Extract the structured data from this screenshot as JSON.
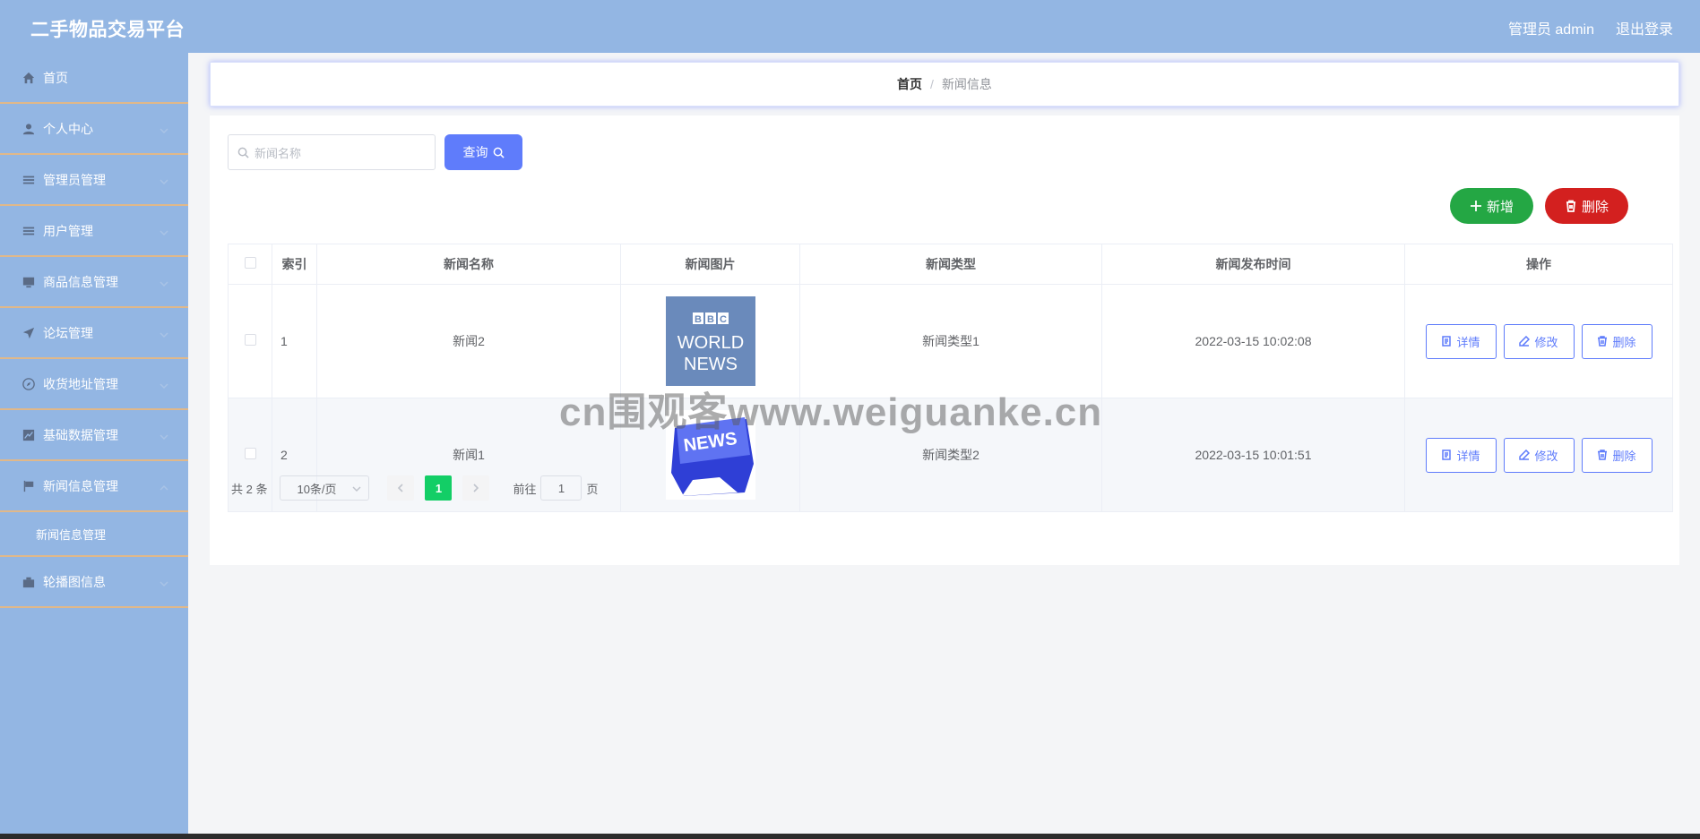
{
  "header": {
    "title": "二手物品交易平台",
    "user_label": "管理员 admin",
    "logout_label": "退出登录"
  },
  "sidebar": {
    "items": [
      {
        "label": "首页",
        "icon": "home-icon"
      },
      {
        "label": "个人中心",
        "icon": "user-icon"
      },
      {
        "label": "管理员管理",
        "icon": "list-icon"
      },
      {
        "label": "用户管理",
        "icon": "list-icon"
      },
      {
        "label": "商品信息管理",
        "icon": "monitor-icon"
      },
      {
        "label": "论坛管理",
        "icon": "send-icon"
      },
      {
        "label": "收货地址管理",
        "icon": "compass-icon"
      },
      {
        "label": "基础数据管理",
        "icon": "chart-icon"
      },
      {
        "label": "新闻信息管理",
        "icon": "flag-icon"
      },
      {
        "label": "轮播图信息",
        "icon": "briefcase-icon"
      }
    ],
    "submenu": {
      "label": "新闻信息管理"
    }
  },
  "breadcrumb": {
    "home": "首页",
    "separator": "/",
    "current": "新闻信息"
  },
  "search": {
    "placeholder": "新闻名称",
    "button_label": "查询"
  },
  "actions": {
    "add_label": "新增",
    "delete_label": "删除"
  },
  "table": {
    "headers": [
      "索引",
      "新闻名称",
      "新闻图片",
      "新闻类型",
      "新闻发布时间",
      "操作"
    ],
    "rows": [
      {
        "index": "1",
        "name": "新闻2",
        "image_text": "BBC WORLD NEWS",
        "type": "新闻类型1",
        "time": "2022-03-15 10:02:08"
      },
      {
        "index": "2",
        "name": "新闻1",
        "image_text": "NEWS",
        "type": "新闻类型2",
        "time": "2022-03-15 10:01:51"
      }
    ],
    "row_actions": {
      "detail": "详情",
      "edit": "修改",
      "delete": "删除"
    }
  },
  "pagination": {
    "total": "共 2 条",
    "page_size": "10条/页",
    "current_page": "1",
    "goto_prefix": "前往",
    "goto_value": "1",
    "goto_suffix": "页"
  },
  "watermark": "cn围观客www.weiguanke.cn",
  "colors": {
    "header_bg": "#93b6e3",
    "primary": "#5f7cfb",
    "success": "#24a744",
    "danger": "#d3201f",
    "active_page": "#13ce66"
  }
}
